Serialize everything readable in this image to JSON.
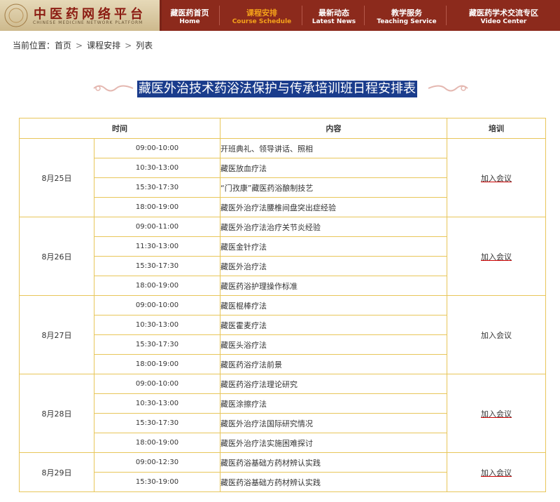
{
  "header": {
    "logo_title": "中医药网络平台",
    "logo_subtitle": "CHINESE MEDICINE NETWORK PLATFORM",
    "nav": [
      {
        "cn": "藏医药首页",
        "en": "Home"
      },
      {
        "cn": "课程安排",
        "en": "Course Schedule"
      },
      {
        "cn": "最新动态",
        "en": "Latest News"
      },
      {
        "cn": "教学服务",
        "en": "Teaching Service"
      },
      {
        "cn": "藏医药学术交流专区",
        "en": "Video Center"
      }
    ],
    "active_color": "#f4a21a",
    "bg_color": "#8c2a1c"
  },
  "breadcrumb": {
    "prefix": "当前位置：",
    "items": [
      "首页",
      "课程安排",
      "列表"
    ],
    "separator": ">"
  },
  "page_title": "藏医外治技术药浴法保护与传承培训班日程安排表",
  "table": {
    "headers": [
      "时间",
      "内容",
      "培训"
    ],
    "days": [
      {
        "date": "8月25日",
        "join": "加入会议",
        "sessions": [
          {
            "time": "09:00-10:00",
            "content": "开班典礼、领导讲话、照相"
          },
          {
            "time": "10:30-13:00",
            "content": "藏医放血疗法"
          },
          {
            "time": "15:30-17:30",
            "content": "“门孜康”藏医药浴酿制技艺"
          },
          {
            "time": "18:00-19:00",
            "content": "藏医外治疗法腰椎间盘突出症经验"
          }
        ]
      },
      {
        "date": "8月26日",
        "join": "加入会议",
        "sessions": [
          {
            "time": "09:00-11:00",
            "content": "藏医外治疗法治疗关节炎经验"
          },
          {
            "time": "11:30-13:00",
            "content": "藏医金针疗法"
          },
          {
            "time": "15:30-17:30",
            "content": "藏医外治疗法"
          },
          {
            "time": "18:00-19:00",
            "content": "藏医药浴护理操作标准"
          }
        ]
      },
      {
        "date": "8月27日",
        "join": "加入会议",
        "sessions": [
          {
            "time": "09:00-10:00",
            "content": "藏医棍棒疗法"
          },
          {
            "time": "10:30-13:00",
            "content": "藏医霍麦疗法"
          },
          {
            "time": "15:30-17:30",
            "content": "藏医头浴疗法"
          },
          {
            "time": "18:00-19:00",
            "content": "藏医药浴疗法前景"
          }
        ]
      },
      {
        "date": "8月28日",
        "join": "加入会议",
        "sessions": [
          {
            "time": "09:00-10:00",
            "content": "藏医药浴疗法理论研究"
          },
          {
            "time": "10:30-13:00",
            "content": "藏医涂擦疗法"
          },
          {
            "time": "15:30-17:30",
            "content": "藏医外治疗法国际研究情况"
          },
          {
            "time": "18:00-19:00",
            "content": "藏医外治疗法实施困难探讨"
          }
        ]
      },
      {
        "date": "8月29日",
        "join": "加入会议",
        "sessions": [
          {
            "time": "09:00-12:30",
            "content": "藏医药浴基础方药材辨认实践"
          },
          {
            "time": "15:30-19:00",
            "content": "藏医药浴基础方药材辨认实践"
          }
        ]
      }
    ]
  },
  "colors": {
    "border": "#e8c65a",
    "title_bg": "#1a3c8c",
    "link_underline": "#cc0000"
  }
}
